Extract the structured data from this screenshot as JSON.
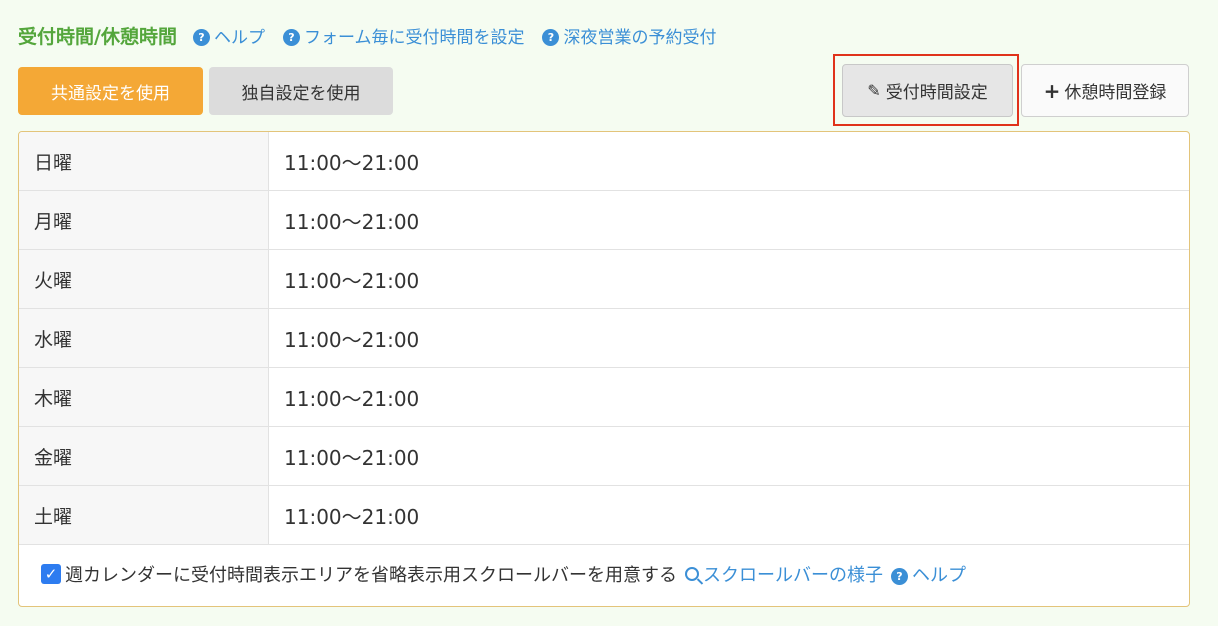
{
  "header": {
    "title": "受付時間/休憩時間",
    "links": [
      "ヘルプ",
      "フォーム毎に受付時間を設定",
      "深夜営業の予約受付"
    ]
  },
  "buttons": {
    "common": "共通設定を使用",
    "own": "独自設定を使用",
    "reception": "受付時間設定",
    "break": "休憩時間登録"
  },
  "schedule": [
    {
      "day": "日曜",
      "time": "11:00〜21:00"
    },
    {
      "day": "月曜",
      "time": "11:00〜21:00"
    },
    {
      "day": "火曜",
      "time": "11:00〜21:00"
    },
    {
      "day": "水曜",
      "time": "11:00〜21:00"
    },
    {
      "day": "木曜",
      "time": "11:00〜21:00"
    },
    {
      "day": "金曜",
      "time": "11:00〜21:00"
    },
    {
      "day": "土曜",
      "time": "11:00〜21:00"
    }
  ],
  "footer": {
    "checkbox_checked": true,
    "checkbox_label": "週カレンダーに受付時間表示エリアを省略表示用スクロールバーを用意する",
    "preview_link": "スクロールバーの様子",
    "help_link": "ヘルプ"
  },
  "colors": {
    "title": "#54a63c",
    "link": "#3b8fd6",
    "accent": "#f4a836",
    "highlight": "#e0321b"
  }
}
